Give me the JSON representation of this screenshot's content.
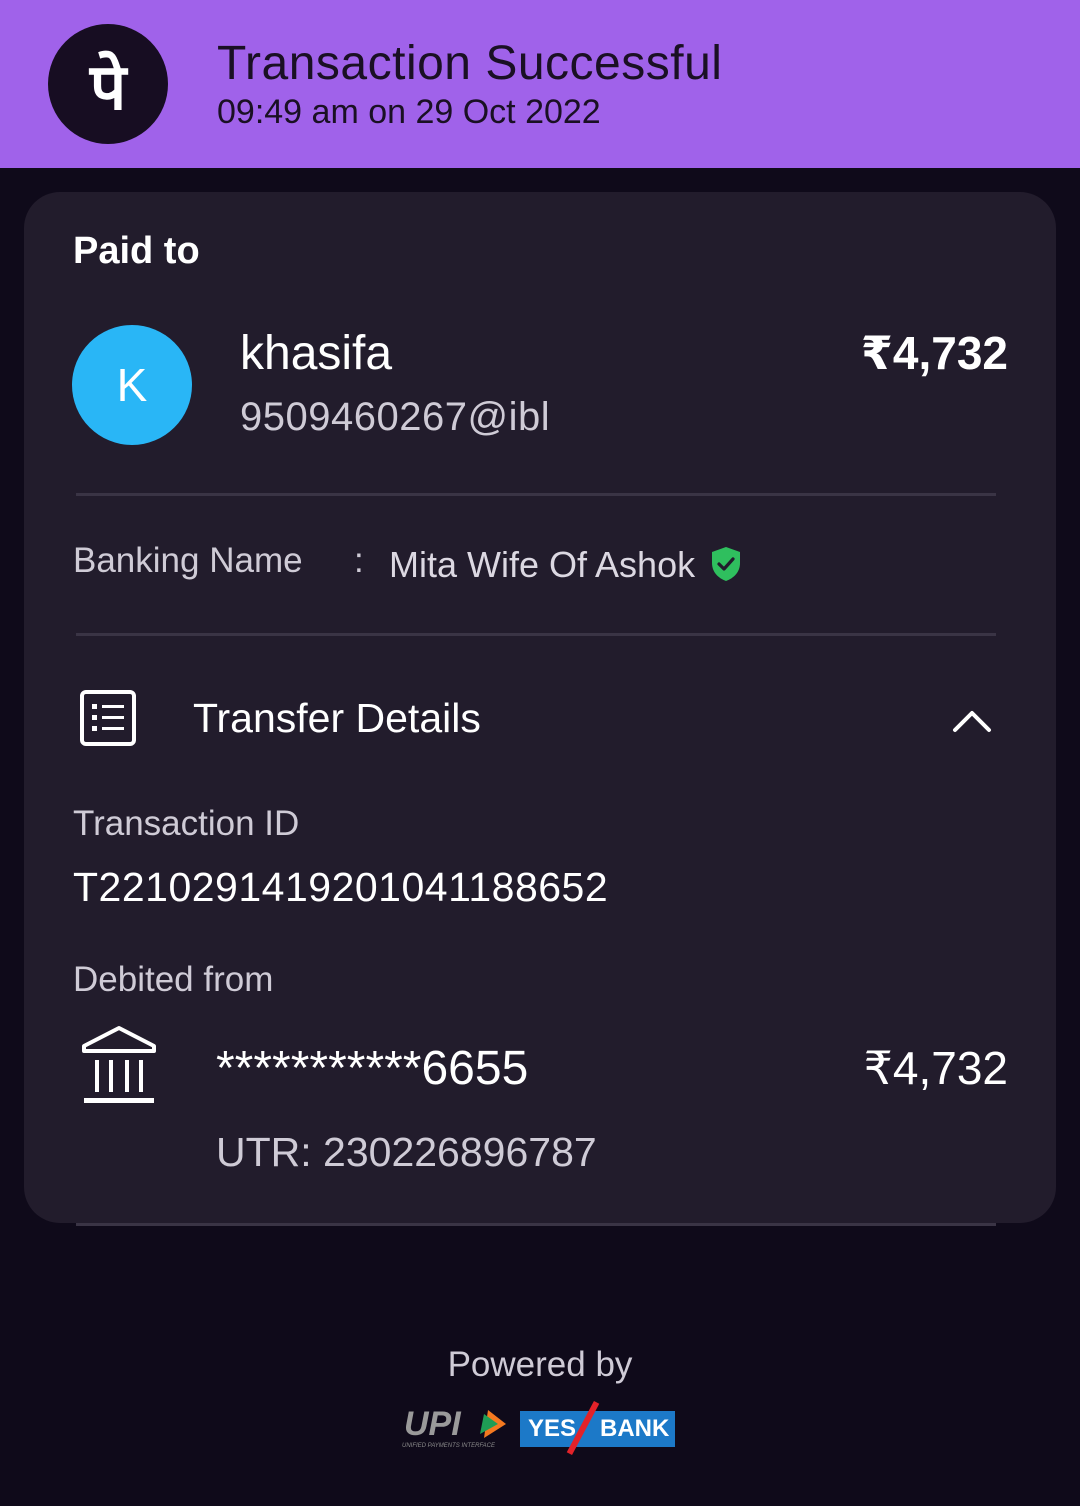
{
  "header": {
    "logo_glyph": "पे",
    "title": "Transaction Successful",
    "timestamp": "09:49 am on 29 Oct 2022",
    "bg_color": "#a062ea"
  },
  "payment": {
    "section_label": "Paid to",
    "avatar_letter": "K",
    "avatar_color": "#29b6f6",
    "payee_name": "khasifa",
    "payee_upi": "9509460267@ibl",
    "amount": "₹4,732",
    "banking_name_label": "Banking Name",
    "banking_name_separator": ":",
    "banking_name_value": "Mita Wife Of Ashok",
    "verified_icon": "shield-check-icon"
  },
  "transfer_details": {
    "section_label": "Transfer Details",
    "section_icon": "receipt-list-icon",
    "toggle_icon": "chevron-up-icon",
    "transaction_id_label": "Transaction ID",
    "transaction_id_value": "T2210291419201041188652",
    "debited_from_label": "Debited from",
    "bank_icon": "bank-icon",
    "account_masked": "***********6655",
    "debited_amount": "₹4,732",
    "utr": "UTR: 230226896787"
  },
  "footer": {
    "powered_by": "Powered by",
    "upi_label": "UPI",
    "upi_sublabel": "UNIFIED PAYMENTS INTERFACE",
    "bank_yes": "YES",
    "bank_bank": "BANK"
  }
}
